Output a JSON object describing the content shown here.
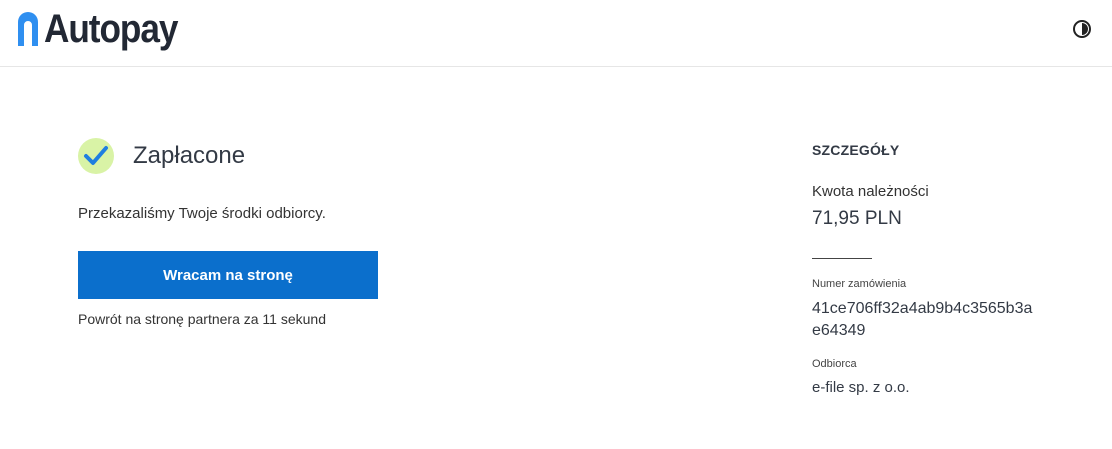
{
  "header": {
    "brand": "Autopay",
    "brand_color": "#2f8ff0",
    "contrast_icon": "contrast-icon"
  },
  "status": {
    "icon": "checkmark-icon",
    "icon_bg": "#d9f3a6",
    "icon_color": "#1f7fe0",
    "title": "Zapłacone",
    "message": "Przekazaliśmy Twoje środki odbiorcy.",
    "button_label": "Wracam na stronę",
    "button_color": "#0b6fcc",
    "countdown_text": "Powrót na stronę partnera za 11 sekund"
  },
  "details": {
    "heading": "SZCZEGÓŁY",
    "amount_label": "Kwota należności",
    "amount_value": "71,95 PLN",
    "order_label": "Numer zamówienia",
    "order_value": "41ce706ff32a4ab9b4c3565b3ae64349",
    "recipient_label": "Odbiorca",
    "recipient_value": "e-file sp. z o.o."
  }
}
